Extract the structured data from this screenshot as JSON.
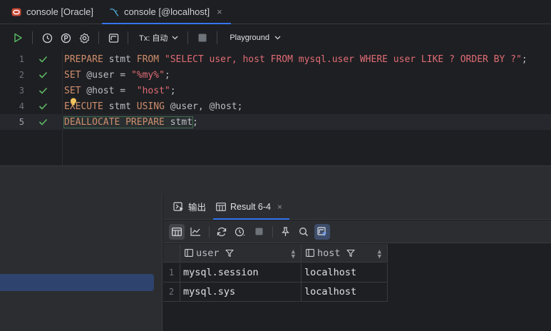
{
  "tabs": [
    {
      "label": "console [Oracle]",
      "icon": "oracle-icon",
      "active": false
    },
    {
      "label": "console [@localhost]",
      "icon": "mysql-icon",
      "active": true,
      "close": "×"
    }
  ],
  "toolbar": {
    "tx_label": "Tx: 自动",
    "playground_label": "Playground"
  },
  "editor": {
    "lines": [
      {
        "num": "1",
        "status": "check-icon"
      },
      {
        "num": "2",
        "status": "check-icon"
      },
      {
        "num": "3",
        "status": "check-icon"
      },
      {
        "num": "4",
        "status": "check-icon"
      },
      {
        "num": "5",
        "status": "check-icon"
      }
    ],
    "code": {
      "l1_kw1": "PREPARE",
      "l1_t1": " stmt ",
      "l1_kw2": "FROM",
      "l1_t2": " ",
      "l1_str": "\"SELECT user, host FROM mysql.user WHERE user LIKE ? ORDER BY ?\"",
      "l1_t3": ";",
      "l2_kw": "SET",
      "l2_t1": " @user = ",
      "l2_str": "\"%my%\"",
      "l2_t2": ";",
      "l3_kw": "SET",
      "l3_t1": " @host =  ",
      "l3_str": "\"host\"",
      "l3_t2": ";",
      "l4_kw1": "EXECUTE",
      "l4_t1": " stmt ",
      "l4_kw2": "USING",
      "l4_t2": " @user, @host;",
      "l5_kw": "DEALLOCATE PREPARE",
      "l5_t1": " stmt",
      "l5_t2": ";"
    }
  },
  "results": {
    "tabs": [
      {
        "label": "输出",
        "icon": "output-icon"
      },
      {
        "label": "Result 6-4",
        "icon": "table-icon",
        "close": "×"
      }
    ],
    "columns": [
      {
        "name": "user"
      },
      {
        "name": "host"
      }
    ],
    "rows": [
      {
        "num": "1",
        "user": "mysql.session",
        "host": "localhost"
      },
      {
        "num": "2",
        "user": "mysql.sys",
        "host": "localhost"
      }
    ]
  },
  "colors": {
    "accent": "#3574f0",
    "keyword": "#cf8e6d",
    "string": "#e06c75",
    "check": "#5fb865"
  }
}
